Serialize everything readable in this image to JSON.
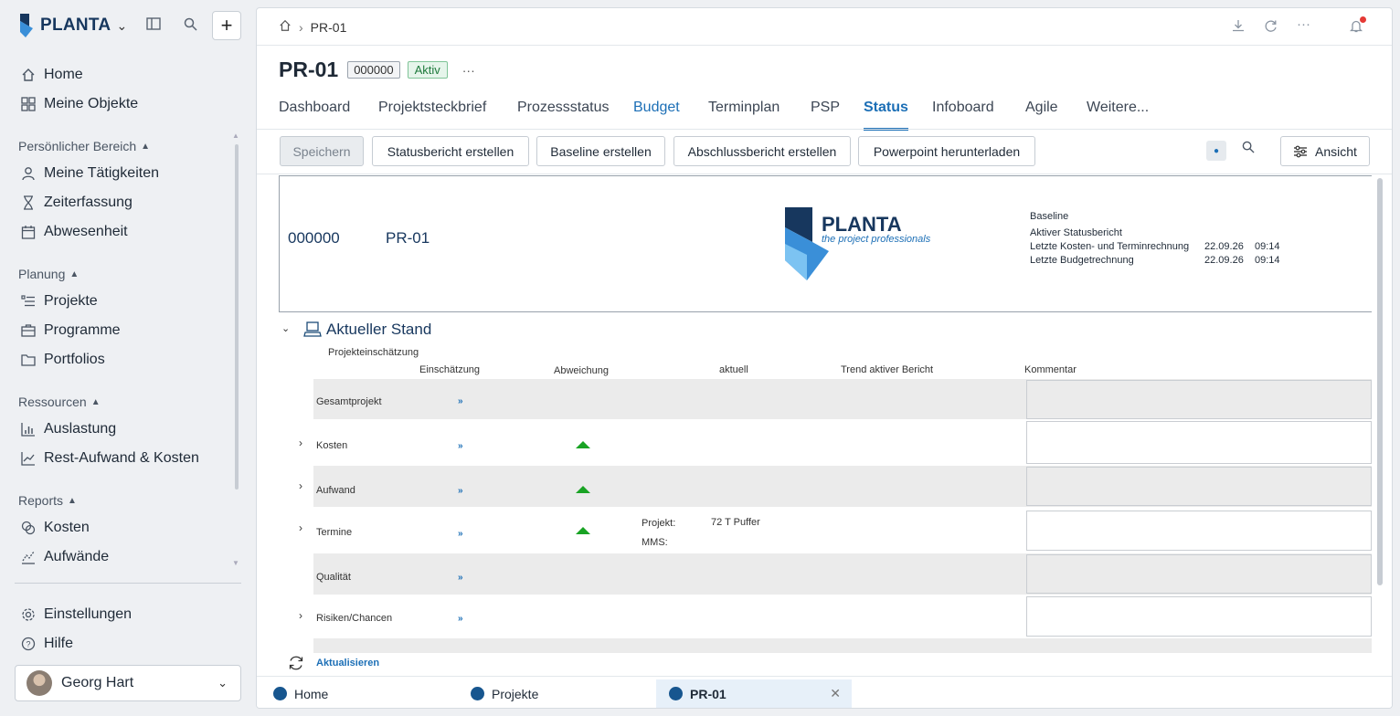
{
  "app": {
    "logo_text": "PLANTA"
  },
  "sidebar": {
    "top_items": [
      {
        "label": "Home"
      },
      {
        "label": "Meine Objekte"
      }
    ],
    "sections": [
      {
        "title": "Persönlicher Bereich",
        "items": [
          {
            "label": "Meine Tätigkeiten"
          },
          {
            "label": "Zeiterfassung"
          },
          {
            "label": "Abwesenheit"
          }
        ]
      },
      {
        "title": "Planung",
        "items": [
          {
            "label": "Projekte"
          },
          {
            "label": "Programme"
          },
          {
            "label": "Portfolios"
          }
        ]
      },
      {
        "title": "Ressourcen",
        "items": [
          {
            "label": "Auslastung"
          },
          {
            "label": "Rest-Aufwand & Kosten"
          }
        ]
      },
      {
        "title": "Reports",
        "items": [
          {
            "label": "Kosten"
          },
          {
            "label": "Aufwände"
          }
        ]
      }
    ],
    "bottom_items": [
      {
        "label": "Einstellungen"
      },
      {
        "label": "Hilfe"
      }
    ],
    "user": {
      "name": "Georg Hart"
    }
  },
  "breadcrumb": {
    "current": "PR-01"
  },
  "header": {
    "title": "PR-01",
    "id_badge": "000000",
    "status_badge": "Aktiv",
    "more": "···"
  },
  "tabs": [
    {
      "label": "Dashboard"
    },
    {
      "label": "Projektsteckbrief"
    },
    {
      "label": "Prozessstatus"
    },
    {
      "label": "Budget"
    },
    {
      "label": "Terminplan"
    },
    {
      "label": "PSP"
    },
    {
      "label": "Status"
    },
    {
      "label": "Infoboard"
    },
    {
      "label": "Agile"
    },
    {
      "label": "Weitere..."
    }
  ],
  "toolbar": {
    "save": "Speichern",
    "status_report": "Statusbericht erstellen",
    "baseline": "Baseline erstellen",
    "final_report": "Abschlussbericht erstellen",
    "powerpoint": "Powerpoint herunterladen",
    "view": "Ansicht"
  },
  "report": {
    "project_number": "000000",
    "project_name": "PR-01",
    "logo_title": "PLANTA",
    "logo_subtitle": "the project professionals",
    "meta": {
      "baseline_label": "Baseline",
      "active_report_label": "Aktiver Statusbericht",
      "last_cost_label": "Letzte Kosten- und Terminrechnung",
      "last_cost_date": "22.09.26",
      "last_cost_time": "09:14",
      "last_budget_label": "Letzte Budgetrechnung",
      "last_budget_date": "22.09.26",
      "last_budget_time": "09:14"
    }
  },
  "section": {
    "title": "Aktueller Stand",
    "subtitle": "Projekteinschätzung",
    "columns": [
      "Einschätzung",
      "Abweichung",
      "aktuell",
      "Trend aktiver Bericht",
      "Kommentar"
    ],
    "rows": [
      {
        "label": "Gesamtprojekt",
        "link": "»"
      },
      {
        "label": "Kosten",
        "link": "»"
      },
      {
        "label": "Aufwand",
        "link": "»"
      },
      {
        "label": "Termine",
        "link": "»",
        "projekt_label": "Projekt:",
        "projekt_value": "72 T Puffer",
        "mms_label": "MMS:"
      },
      {
        "label": "Qualität",
        "link": "»"
      },
      {
        "label": "Risiken/Chancen",
        "link": "»"
      }
    ],
    "refresh": "Aktualisieren"
  },
  "bottom_tabs": [
    {
      "label": "Home"
    },
    {
      "label": "Projekte"
    },
    {
      "label": "PR-01"
    }
  ],
  "colors": {
    "brand": "#17375e",
    "accent": "#1c6fb6",
    "status_green": "#19a324"
  }
}
